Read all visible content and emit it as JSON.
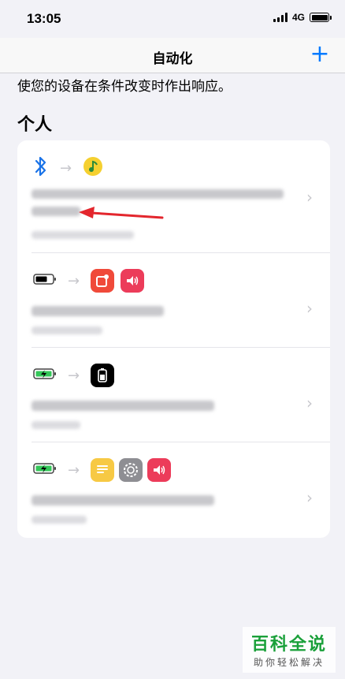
{
  "status": {
    "time": "13:05",
    "network": "4G"
  },
  "nav": {
    "title": "自动化",
    "add_label": "+"
  },
  "subtitle": "使您的设备在条件改变时作出响应。",
  "section_title": "个人",
  "rows": [
    {
      "trigger_icon": "bluetooth-icon",
      "action_icons": [
        "music-app-icon"
      ]
    },
    {
      "trigger_icon": "low-battery-icon",
      "action_icons": [
        "record-app-icon",
        "volume-icon"
      ]
    },
    {
      "trigger_icon": "charging-battery-icon",
      "action_icons": [
        "battery-widget-icon"
      ]
    },
    {
      "trigger_icon": "charging-battery-icon",
      "action_icons": [
        "notes-icon",
        "settings-gear-icon",
        "volume-icon"
      ]
    }
  ],
  "watermark": {
    "title": "百科全说",
    "subtitle": "助你轻松解决"
  },
  "colors": {
    "accent": "#007aff",
    "arrow": "#e3262d",
    "watermark_green": "#1aa03a"
  }
}
